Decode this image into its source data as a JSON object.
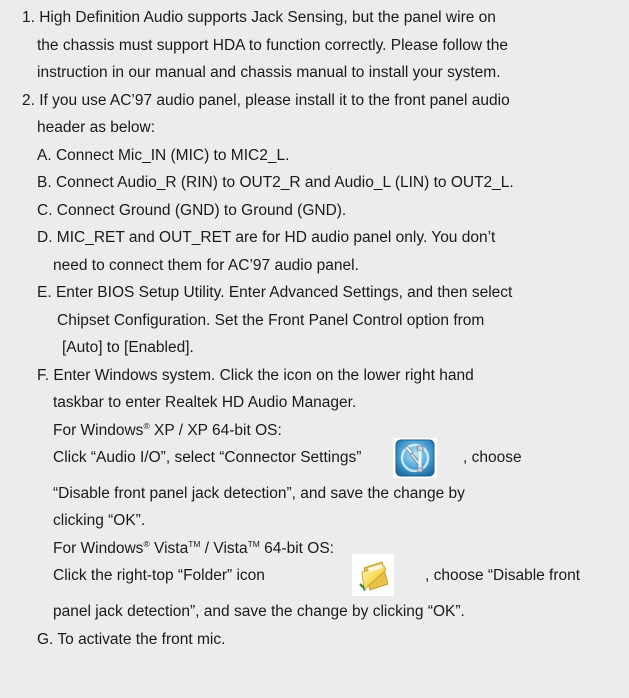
{
  "page": {
    "background": "#ececec",
    "text_color": "#1a1a1a"
  },
  "lines": {
    "l01": "1. High Definition Audio supports Jack Sensing, but the panel wire on",
    "l02": "the chassis must support HDA to function correctly. Please follow the",
    "l03": "instruction in our manual and chassis manual to install your system.",
    "l04": "2. If you use AC’97 audio panel, please install it to the front panel audio",
    "l05": "header as below:",
    "l06": "A. Connect Mic_IN (MIC) to MIC2_L.",
    "l07": "B. Connect Audio_R (RIN) to OUT2_R and Audio_L (LIN) to OUT2_L.",
    "l08": "C. Connect Ground (GND) to Ground (GND).",
    "l09": "D. MIC_RET and OUT_RET are for HD audio panel only. You don’t",
    "l10": "need to connect them for AC’97 audio panel.",
    "l11": "E. Enter BIOS Setup Utility. Enter Advanced Settings, and then select",
    "l12": "Chipset Configuration. Set the Front Panel Control option from",
    "l13": "[Auto] to [Enabled].",
    "l14": "F. Enter Windows system. Click the icon on the lower right hand",
    "l15": "taskbar to enter Realtek HD Audio Manager.",
    "l16": {
      "before": "For Windows",
      "sup1": "®",
      "after": " XP / XP 64-bit OS:"
    },
    "l17a": "Click “Audio I/O”, select “Connector Settings”",
    "l17b": ", choose",
    "l18": "“Disable front panel jack detection”, and save the change by",
    "l19": "clicking “OK”.",
    "l20": {
      "before": "For Windows",
      "sup1": "®",
      "mid": " Vista",
      "sup2": "TM",
      "mid2": " / Vista",
      "sup3": "TM",
      "after": " 64-bit OS:"
    },
    "l21a": "Click the right-top “Folder” icon",
    "l21b": ", choose “Disable front",
    "l22": "panel jack detection”, and save the change by clicking “OK”.",
    "l23": "G. To activate the front mic."
  },
  "icons": {
    "connector_settings": "connector-settings-icon",
    "folder": "folder-icon"
  }
}
